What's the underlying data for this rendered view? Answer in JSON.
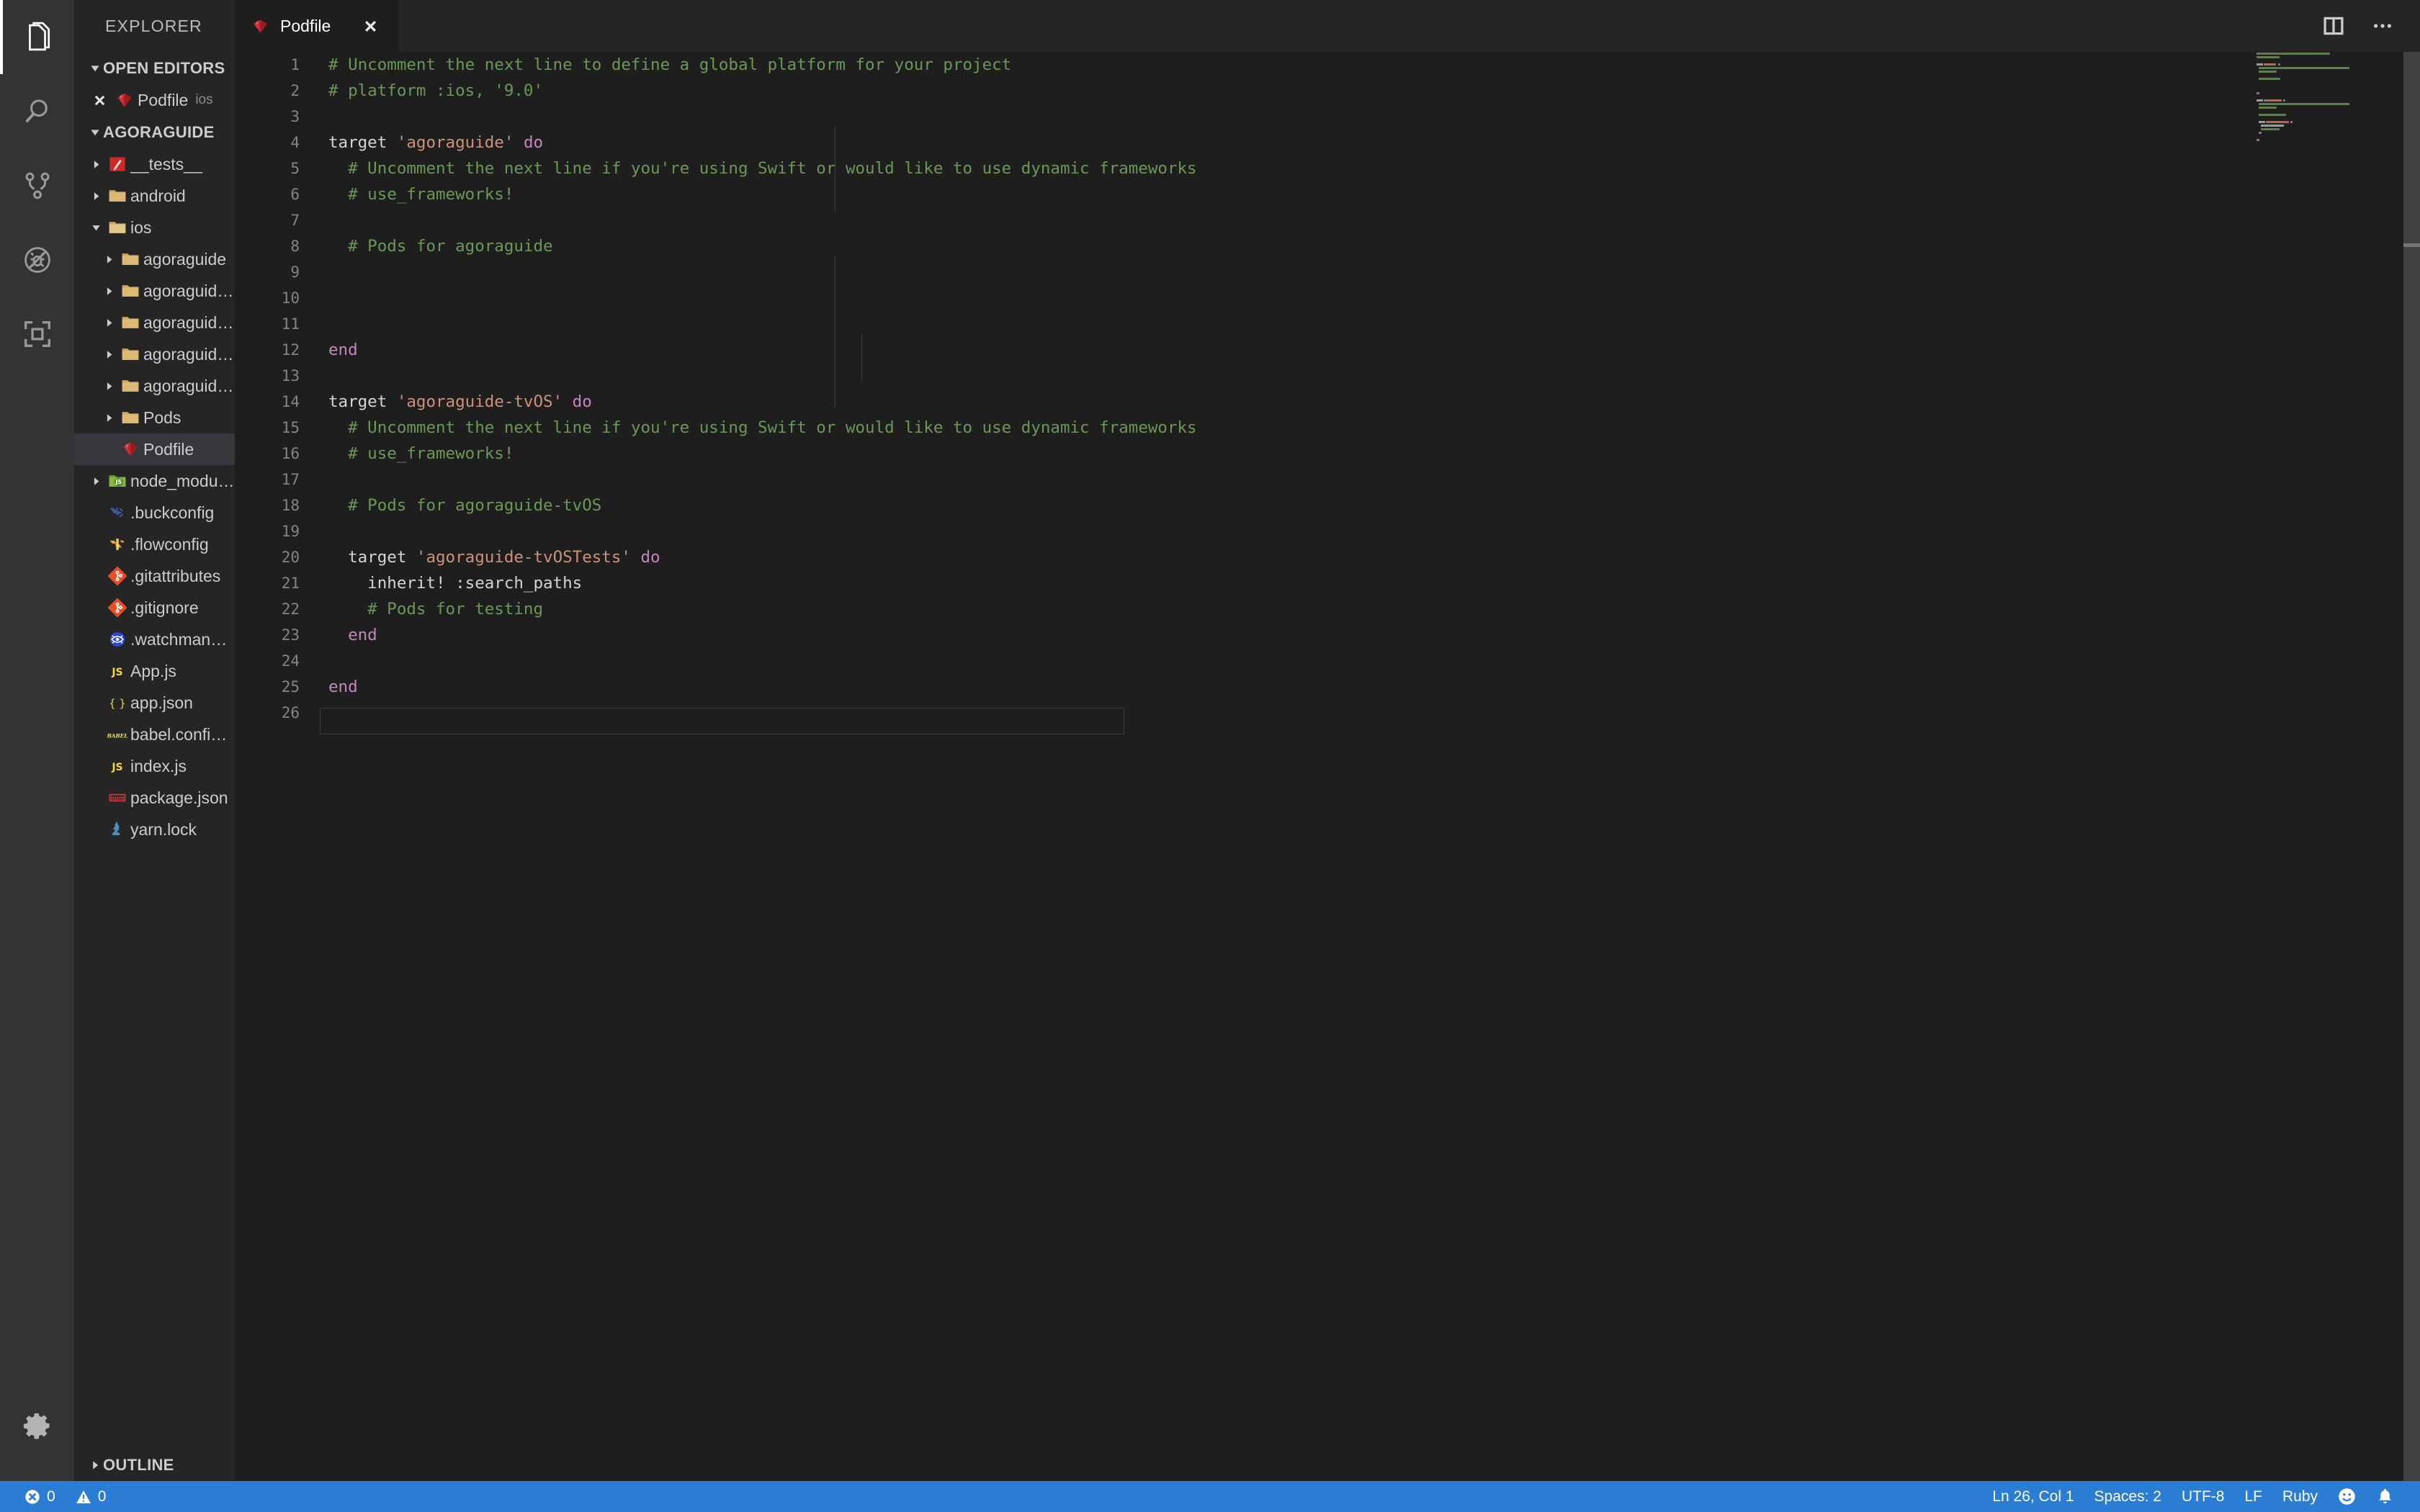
{
  "activitybar": {
    "items": [
      {
        "name": "explorer",
        "icon": "files-icon",
        "active": true
      },
      {
        "name": "search",
        "icon": "search-icon",
        "active": false
      },
      {
        "name": "source-control",
        "icon": "source-control-icon",
        "active": false
      },
      {
        "name": "run-debug",
        "icon": "run-debug-icon",
        "active": false
      },
      {
        "name": "extensions",
        "icon": "extensions-icon",
        "active": false
      }
    ],
    "manage_icon": "gear-icon"
  },
  "sidebar": {
    "title": "EXPLORER",
    "open_editors": {
      "header": "OPEN EDITORS",
      "expanded": true,
      "items": [
        {
          "label": "Podfile",
          "sublabel": "ios",
          "icon": "ruby-icon",
          "dirty": false
        }
      ]
    },
    "workspace": {
      "header": "AGORAGUIDE",
      "expanded": true
    },
    "tree": [
      {
        "label": "__tests__",
        "icon": "ruby-test-icon",
        "type": "folder",
        "depth": 1,
        "expanded": false
      },
      {
        "label": "android",
        "icon": "folder-icon",
        "type": "folder",
        "depth": 1,
        "expanded": false
      },
      {
        "label": "ios",
        "icon": "folder-open-icon",
        "type": "folder",
        "depth": 1,
        "expanded": true
      },
      {
        "label": "agoraguide",
        "icon": "folder-icon",
        "type": "folder",
        "depth": 2,
        "expanded": false
      },
      {
        "label": "agoraguide-tvOS",
        "icon": "folder-icon",
        "type": "folder",
        "depth": 2,
        "expanded": false
      },
      {
        "label": "agoraguide-tvOSTests",
        "icon": "folder-icon",
        "type": "folder",
        "depth": 2,
        "expanded": false
      },
      {
        "label": "agoraguide.xcodeproj",
        "icon": "folder-icon",
        "type": "folder",
        "depth": 2,
        "expanded": false
      },
      {
        "label": "agoraguideTests",
        "icon": "folder-icon",
        "type": "folder",
        "depth": 2,
        "expanded": false
      },
      {
        "label": "Pods",
        "icon": "folder-icon",
        "type": "folder",
        "depth": 2,
        "expanded": false
      },
      {
        "label": "Podfile",
        "icon": "ruby-icon",
        "type": "file",
        "depth": 2,
        "selected": true
      },
      {
        "label": "node_modules",
        "icon": "nodejs-folder-icon",
        "type": "folder",
        "depth": 1,
        "expanded": false
      },
      {
        "label": ".buckconfig",
        "icon": "buck-icon",
        "type": "file",
        "depth": 1
      },
      {
        "label": ".flowconfig",
        "icon": "flow-icon",
        "type": "file",
        "depth": 1
      },
      {
        "label": ".gitattributes",
        "icon": "git-icon",
        "type": "file",
        "depth": 1
      },
      {
        "label": ".gitignore",
        "icon": "git-icon",
        "type": "file",
        "depth": 1
      },
      {
        "label": ".watchmanconfig",
        "icon": "watchman-icon",
        "type": "file",
        "depth": 1
      },
      {
        "label": "App.js",
        "icon": "js-icon",
        "type": "file",
        "depth": 1
      },
      {
        "label": "app.json",
        "icon": "json-icon",
        "type": "file",
        "depth": 1
      },
      {
        "label": "babel.config.js",
        "icon": "babel-icon",
        "type": "file",
        "depth": 1
      },
      {
        "label": "index.js",
        "icon": "js-icon",
        "type": "file",
        "depth": 1
      },
      {
        "label": "package.json",
        "icon": "npm-icon",
        "type": "file",
        "depth": 1
      },
      {
        "label": "yarn.lock",
        "icon": "yarn-icon",
        "type": "file",
        "depth": 1
      }
    ],
    "outline": {
      "header": "OUTLINE",
      "expanded": false
    }
  },
  "editor": {
    "tabs": [
      {
        "label": "Podfile",
        "icon": "ruby-icon",
        "active": true,
        "close_icon": "close-icon"
      }
    ],
    "actions": [
      {
        "name": "split-editor-button",
        "icon": "split-editor-icon"
      },
      {
        "name": "more-actions-button",
        "icon": "ellipsis-icon"
      }
    ],
    "current_line": 26,
    "lines": [
      {
        "n": 1,
        "tokens": [
          {
            "t": "# Uncomment the next line to define a global platform for your project",
            "c": "cm"
          }
        ]
      },
      {
        "n": 2,
        "tokens": [
          {
            "t": "# platform :ios, '9.0'",
            "c": "cm"
          }
        ]
      },
      {
        "n": 3,
        "tokens": []
      },
      {
        "n": 4,
        "tokens": [
          {
            "t": "target ",
            "c": "id"
          },
          {
            "t": "'agoraguide'",
            "c": "st"
          },
          {
            "t": " ",
            "c": "id"
          },
          {
            "t": "do",
            "c": "kw"
          }
        ]
      },
      {
        "n": 5,
        "tokens": [
          {
            "t": "  # Uncomment the next line if you're using Swift or would like to use dynamic frameworks",
            "c": "cm"
          }
        ]
      },
      {
        "n": 6,
        "tokens": [
          {
            "t": "  # use_frameworks!",
            "c": "cm"
          }
        ]
      },
      {
        "n": 7,
        "tokens": []
      },
      {
        "n": 8,
        "tokens": [
          {
            "t": "  # Pods for agoraguide",
            "c": "cm"
          }
        ]
      },
      {
        "n": 9,
        "tokens": []
      },
      {
        "n": 10,
        "tokens": []
      },
      {
        "n": 11,
        "tokens": []
      },
      {
        "n": 12,
        "tokens": [
          {
            "t": "end",
            "c": "kw"
          }
        ]
      },
      {
        "n": 13,
        "tokens": []
      },
      {
        "n": 14,
        "tokens": [
          {
            "t": "target ",
            "c": "id"
          },
          {
            "t": "'agoraguide-tvOS'",
            "c": "st"
          },
          {
            "t": " ",
            "c": "id"
          },
          {
            "t": "do",
            "c": "kw"
          }
        ]
      },
      {
        "n": 15,
        "tokens": [
          {
            "t": "  # Uncomment the next line if you're using Swift or would like to use dynamic frameworks",
            "c": "cm"
          }
        ]
      },
      {
        "n": 16,
        "tokens": [
          {
            "t": "  # use_frameworks!",
            "c": "cm"
          }
        ]
      },
      {
        "n": 17,
        "tokens": []
      },
      {
        "n": 18,
        "tokens": [
          {
            "t": "  # Pods for agoraguide-tvOS",
            "c": "cm"
          }
        ]
      },
      {
        "n": 19,
        "tokens": []
      },
      {
        "n": 20,
        "tokens": [
          {
            "t": "  target ",
            "c": "id"
          },
          {
            "t": "'agoraguide-tvOSTests'",
            "c": "st"
          },
          {
            "t": " ",
            "c": "id"
          },
          {
            "t": "do",
            "c": "kw"
          }
        ]
      },
      {
        "n": 21,
        "tokens": [
          {
            "t": "    inherit! :search_paths",
            "c": "id"
          }
        ]
      },
      {
        "n": 22,
        "tokens": [
          {
            "t": "    # Pods for testing",
            "c": "cm"
          }
        ]
      },
      {
        "n": 23,
        "tokens": [
          {
            "t": "  ",
            "c": "id"
          },
          {
            "t": "end",
            "c": "kw"
          }
        ]
      },
      {
        "n": 24,
        "tokens": []
      },
      {
        "n": 25,
        "tokens": [
          {
            "t": "end",
            "c": "kw"
          }
        ]
      },
      {
        "n": 26,
        "tokens": []
      }
    ]
  },
  "statusbar": {
    "left": [
      {
        "name": "problems-errors",
        "icon": "error-icon",
        "value": "0"
      },
      {
        "name": "problems-warnings",
        "icon": "warning-icon",
        "value": "0"
      }
    ],
    "right": [
      {
        "name": "cursor-position",
        "value": "Ln 26, Col 1"
      },
      {
        "name": "indentation",
        "value": "Spaces: 2"
      },
      {
        "name": "encoding",
        "value": "UTF-8"
      },
      {
        "name": "eol",
        "value": "LF"
      },
      {
        "name": "language-mode",
        "value": "Ruby"
      },
      {
        "name": "feedback-smiley",
        "icon": "smiley-icon",
        "value": ""
      },
      {
        "name": "notifications-bell",
        "icon": "bell-icon",
        "value": ""
      }
    ]
  },
  "colors": {
    "accent": "#2b7cd3",
    "editor_bg": "#1e1e1e",
    "sidebar_bg": "#252526",
    "activitybar_bg": "#333333",
    "comment": "#6A9955",
    "string": "#CE9178",
    "keyword": "#C586C0",
    "text": "#d4d4d4",
    "selection_bg": "#37373d"
  }
}
